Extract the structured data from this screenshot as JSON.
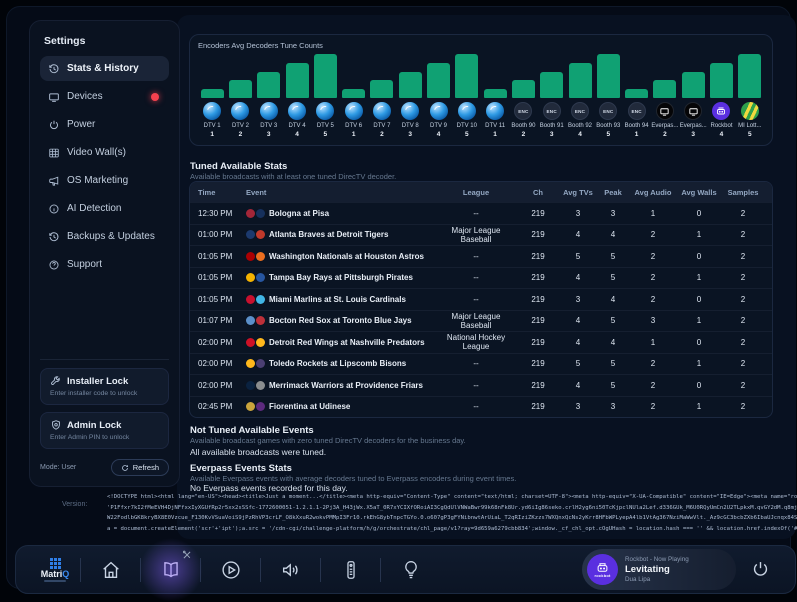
{
  "sidebar": {
    "title": "Settings",
    "items": [
      {
        "label": "Stats & History",
        "icon": "history-icon",
        "selected": true
      },
      {
        "label": "Devices",
        "icon": "tv-icon",
        "badge": true
      },
      {
        "label": "Power",
        "icon": "power-icon"
      },
      {
        "label": "Video Wall(s)",
        "icon": "grid-icon"
      },
      {
        "label": "OS Marketing",
        "icon": "megaphone-icon"
      },
      {
        "label": "AI Detection",
        "icon": "info-icon"
      },
      {
        "label": "Backups & Updates",
        "icon": "restore-icon"
      },
      {
        "label": "Support",
        "icon": "help-icon"
      }
    ],
    "installer_lock": {
      "title": "Installer Lock",
      "subtitle": "Enter installer code to unlock"
    },
    "admin_lock": {
      "title": "Admin Lock",
      "subtitle": "Enter Admin PIN to unlock"
    },
    "mode_label": "Mode: User",
    "refresh_label": "Refresh"
  },
  "chart_data": {
    "type": "bar",
    "title": "Encoders Avg Decoders Tune Counts",
    "categories": [
      "DTV 1",
      "DTV 2",
      "DTV 3",
      "DTV 4",
      "DTV 5",
      "DTV 6",
      "DTV 7",
      "DTV 8",
      "DTV 9",
      "DTV 10",
      "DTV 11",
      "Booth 90",
      "Booth 91",
      "Booth 92",
      "Booth 93",
      "Booth 94",
      "Everpas...",
      "Everpas...",
      "Rockbot",
      "MI Lott..."
    ],
    "values": [
      1,
      2,
      3,
      4,
      5,
      1,
      2,
      3,
      4,
      5,
      1,
      2,
      3,
      4,
      5,
      1,
      2,
      3,
      4,
      5
    ],
    "icons": [
      "dtv",
      "dtv",
      "dtv",
      "dtv",
      "dtv",
      "dtv",
      "dtv",
      "dtv",
      "dtv",
      "dtv",
      "dtv",
      "enc",
      "enc",
      "enc",
      "enc",
      "enc",
      "everpass",
      "everpass",
      "rockbot",
      "milottery"
    ],
    "enc_label": "ENC",
    "bar_color": "#10a173",
    "ylim": [
      0,
      5
    ],
    "legend": "none",
    "grid": false
  },
  "tuned_stats": {
    "title": "Tuned Available Stats",
    "subtitle": "Available broadcasts with at least one tuned DirecTV decoder.",
    "columns": [
      "Time",
      "Event",
      "League",
      "Ch",
      "Avg TVs",
      "Peak",
      "Avg Audio",
      "Avg Walls",
      "Samples"
    ],
    "rows": [
      {
        "time": "12:30 PM",
        "event": "Bologna at Pisa",
        "league": "--",
        "ch": "219",
        "avg_tvs": "3",
        "peak": "3",
        "avg_audio": "1",
        "avg_walls": "0",
        "samples": "2",
        "logo_colors": [
          "#a32638",
          "#16305c"
        ]
      },
      {
        "time": "01:00 PM",
        "event": "Atlanta Braves at Detroit Tigers",
        "league": "Major League Baseball",
        "ch": "219",
        "avg_tvs": "4",
        "peak": "4",
        "avg_audio": "2",
        "avg_walls": "1",
        "samples": "2",
        "logo_colors": [
          "#1c3a6e",
          "#c0392b"
        ]
      },
      {
        "time": "01:05 PM",
        "event": "Washington Nationals at Houston Astros",
        "league": "--",
        "ch": "219",
        "avg_tvs": "5",
        "peak": "5",
        "avg_audio": "2",
        "avg_walls": "0",
        "samples": "2",
        "logo_colors": [
          "#ab0003",
          "#eb6e1f"
        ]
      },
      {
        "time": "01:05 PM",
        "event": "Tampa Bay Rays at Pittsburgh Pirates",
        "league": "--",
        "ch": "219",
        "avg_tvs": "4",
        "peak": "5",
        "avg_audio": "2",
        "avg_walls": "1",
        "samples": "2",
        "logo_colors": [
          "#f5b300",
          "#2756a0"
        ]
      },
      {
        "time": "01:05 PM",
        "event": "Miami Marlins at St. Louis Cardinals",
        "league": "--",
        "ch": "219",
        "avg_tvs": "3",
        "peak": "4",
        "avg_audio": "2",
        "avg_walls": "0",
        "samples": "2",
        "logo_colors": [
          "#c8102e",
          "#41b6e6"
        ]
      },
      {
        "time": "01:07 PM",
        "event": "Bocton Red Sox at Toronto Blue Jays",
        "league": "Major League Baseball",
        "ch": "219",
        "avg_tvs": "4",
        "peak": "5",
        "avg_audio": "3",
        "avg_walls": "1",
        "samples": "2",
        "logo_colors": [
          "#5b8fc9",
          "#bd3039"
        ]
      },
      {
        "time": "02:00 PM",
        "event": "Detroit Red Wings at Nashville Predators",
        "league": "National Hockey League",
        "ch": "219",
        "avg_tvs": "4",
        "peak": "4",
        "avg_audio": "1",
        "avg_walls": "0",
        "samples": "2",
        "logo_colors": [
          "#ce1126",
          "#ffb81c"
        ]
      },
      {
        "time": "02:00 PM",
        "event": "Toledo Rockets at Lipscomb Bisons",
        "league": "--",
        "ch": "219",
        "avg_tvs": "5",
        "peak": "5",
        "avg_audio": "2",
        "avg_walls": "1",
        "samples": "2",
        "logo_colors": [
          "#ffb81c",
          "#4b3f72"
        ]
      },
      {
        "time": "02:00 PM",
        "event": "Merrimack Warriors at Providence Friars",
        "league": "--",
        "ch": "219",
        "avg_tvs": "4",
        "peak": "5",
        "avg_audio": "2",
        "avg_walls": "0",
        "samples": "2",
        "logo_colors": [
          "#0a2240",
          "#8a8d8f"
        ]
      },
      {
        "time": "02:45 PM",
        "event": "Fiorentina at Udinese",
        "league": "--",
        "ch": "219",
        "avg_tvs": "3",
        "peak": "3",
        "avg_audio": "2",
        "avg_walls": "1",
        "samples": "2",
        "logo_colors": [
          "#caa43c",
          "#5d2a7e"
        ]
      }
    ]
  },
  "not_tuned": {
    "title": "Not Tuned Available Events",
    "subtitle": "Available broadcast games with zero tuned DirecTV decoders for the business day.",
    "message": "All available broadcasts were tuned."
  },
  "everpass": {
    "title": "Everpass Events Stats",
    "subtitle": "Available Everpass events with average decoders tuned to Everpass encoders during event times.",
    "message": "No Everpass events recorded for this day."
  },
  "version": {
    "label": "Version:",
    "lines": [
      "<!DOCTYPE html><html lang=\"en-US\"><head><title>Just a moment...</title><meta http-equiv=\"Content-Type\" content=\"text/html; charset=UTF-8\"><meta http-equiv=\"X-UA-Compatible\" content=\"IE=Edge\"><meta name=\"robots\" conten",
      "'P1Ffxr7kI2fMeEVH4DjNFfxxIyXGUfRp2r5xx2sSSfc-1772600051-1.2.1.1-2Pj3A_H43jWx.X5aT_0R7xYCIXfORoiAI3CgQdUlVNWaBwr99k68nFk8Ur.yd6iIg86seko.crlH2yg6ni50TcKjpclNUla2Lef.d336GUk_M6U0RQyUmCn2U2TLpkxM.qvGY2dM.q8mj9nk13xfbxnW",
      "W22FodlbGK8kryBX8E0Vzcue_F130KvVSuaVoiS9jPzRhVP3crLF_O8kXxuR2wokvPMMpI3Fr10.rkEhG8ybTnpcTGYo.0.o607gP3gFYNibnwtArUiaL_T2qRIziZKzzs7WXQnxQcNs2yKrr8HFbWPLyepA4lb1VtAg367NziMaWwVlt._Az9cGC3bcbZXb6IbaUJcnqx84SR63ZPzSu_dCW",
      "a = document.createElement('scr'+'ipt');a.src = '/cdn-cgi/challenge-platform/h/g/orchestrate/chl_page/v1?ray=9d659a6279cbb834';window._cf_chl_opt.cOgUHash = location.hash === '' && location.href.indexOf('#') !== -1 ? '#'"
    ]
  },
  "dock": {
    "logo": {
      "main": "Matri",
      "accent": "Q"
    },
    "icons": [
      {
        "name": "home-icon"
      },
      {
        "name": "guide-book-icon",
        "active": true,
        "badge": "tools-badge-icon"
      },
      {
        "name": "play-icon"
      },
      {
        "name": "volume-icon"
      },
      {
        "name": "remote-icon"
      },
      {
        "name": "bulb-icon"
      }
    ],
    "now_playing": {
      "source": "Rockbot - Now Playing",
      "track": "Levitating",
      "artist": "Dua Lipa",
      "logo_label": "rockbot"
    }
  }
}
